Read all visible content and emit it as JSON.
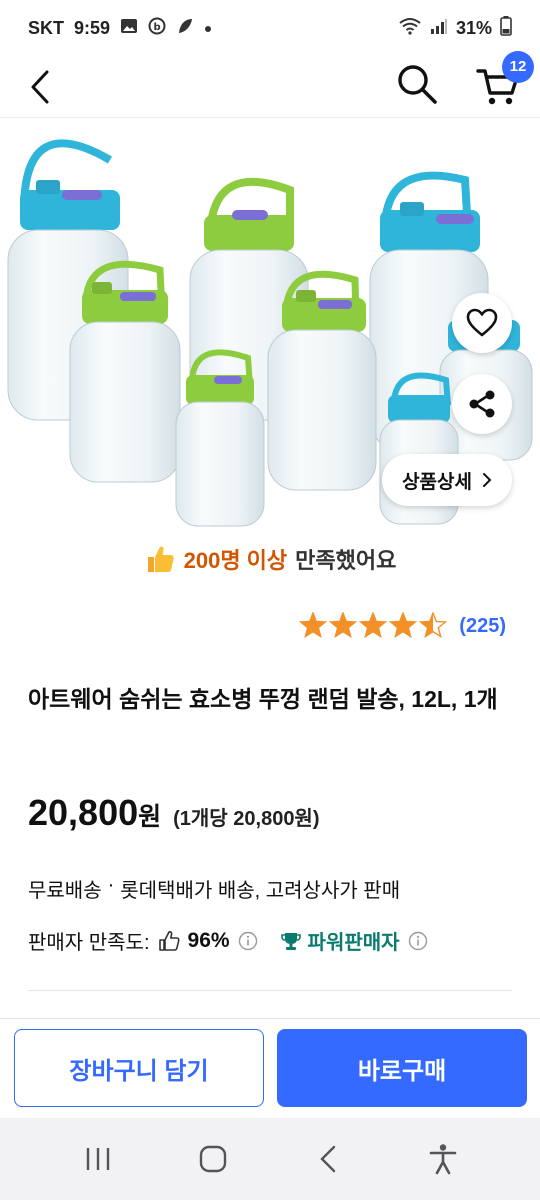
{
  "status_bar": {
    "carrier": "SKT",
    "time": "9:59",
    "battery": "31%"
  },
  "nav": {
    "cart_count": "12"
  },
  "product": {
    "detail_button_label": "상품상세",
    "satisfaction_highlight": "200명 이상",
    "satisfaction_text": " 만족했어요",
    "rating_stars": 4.5,
    "rating_count": "(225)",
    "title": "아트웨어 숨쉬는 효소병 뚜껑 랜덤 발송, 12L, 1개",
    "price": "20,800",
    "price_unit": "원",
    "unit_price": "(1개당 20,800원)",
    "delivery_free": "무료배송",
    "delivery_separator": "·",
    "delivery_detail": "롯데택배가 배송, 고려상사가 판매",
    "seller_satisfaction_label": "판매자 만족도:",
    "seller_satisfaction_value": "96%",
    "power_seller_label": "파워판매자"
  },
  "actions": {
    "add_to_cart": "장바구니 담기",
    "buy_now": "바로구매"
  },
  "colors": {
    "accent": "#346aff",
    "highlight": "#d45500",
    "star": "#f39028",
    "power_seller": "#0a7b6d"
  }
}
